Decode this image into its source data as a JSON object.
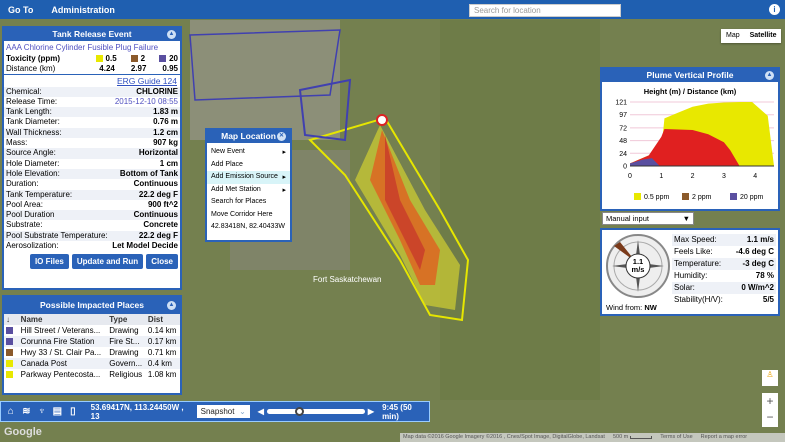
{
  "topbar": {
    "goto": "Go To",
    "admin": "Administration",
    "search_placeholder": "Search for location"
  },
  "maptype": {
    "map": "Map",
    "satellite": "Satellite"
  },
  "tank": {
    "title": "Tank Release Event",
    "event_name": "AAA Chlorine Cylinder Fusible Plug Failure",
    "toxicity_label": "Toxicity (ppm)",
    "distance_label": "Distance (km)",
    "levels": [
      {
        "ppm": "0.5",
        "color": "#e8e800",
        "dist": "4.24"
      },
      {
        "ppm": "2",
        "color": "#8b5a2b",
        "dist": "2.97"
      },
      {
        "ppm": "20",
        "color": "#5a4fa0",
        "dist": "0.95"
      }
    ],
    "erg": "ERG Guide 124",
    "props": [
      [
        "Chemical:",
        "CHLORINE"
      ],
      [
        "Release Time:",
        "2015-12-10 08:55"
      ],
      [
        "Tank Length:",
        "1.83 m"
      ],
      [
        "Tank Diameter:",
        "0.76 m"
      ],
      [
        "Wall Thickness:",
        "1.2 cm"
      ],
      [
        "Mass:",
        "907 kg"
      ],
      [
        "Source Angle:",
        "Horizontal"
      ],
      [
        "Hole Diameter:",
        "1 cm"
      ],
      [
        "Hole Elevation:",
        "Bottom of Tank"
      ],
      [
        "Duration:",
        "Continuous"
      ],
      [
        "Tank Temperature:",
        "22.2 deg F"
      ],
      [
        "Pool Area:",
        "900 ft^2"
      ],
      [
        "Pool Duration",
        "Continuous"
      ],
      [
        "Substrate:",
        "Concrete"
      ],
      [
        "Pool Substrate Temperature:",
        "22.2 deg F"
      ],
      [
        "Aerosolization:",
        "Let Model Decide"
      ]
    ],
    "buttons": {
      "io": "IO Files",
      "update": "Update and Run",
      "close": "Close"
    }
  },
  "places": {
    "title": "Possible Impacted Places",
    "headers": [
      "Name",
      "Type",
      "Dist"
    ],
    "rows": [
      {
        "color": "#5a4fa0",
        "name": "Hill Street / Veterans...",
        "type": "Drawing",
        "dist": "0.14 km"
      },
      {
        "color": "#5a4fa0",
        "name": "Corunna Fire Station",
        "type": "Fire St...",
        "dist": "0.17 km"
      },
      {
        "color": "#8b5a2b",
        "name": "Hwy 33 / St. Clair Pa...",
        "type": "Drawing",
        "dist": "0.71 km"
      },
      {
        "color": "#e8e800",
        "name": "Canada Post",
        "type": "Govern...",
        "dist": "0.4 km"
      },
      {
        "color": "#e8e800",
        "name": "Parkway Pentecosta...",
        "type": "Religious",
        "dist": "1.08 km"
      }
    ]
  },
  "menu": {
    "title": "Map Location",
    "items": [
      {
        "label": "New Event",
        "sub": true
      },
      {
        "label": "Add Place",
        "sub": false
      },
      {
        "label": "Add Emission Source",
        "sub": true
      },
      {
        "label": "Add Met Station",
        "sub": true
      },
      {
        "label": "Search for Places",
        "sub": false
      },
      {
        "label": "Move Corridor Here",
        "sub": false
      }
    ],
    "coords": "42.83418N, 82.40433W"
  },
  "profile": {
    "title": "Plume Vertical Profile",
    "chart_title": "Height (m) / Distance (km)",
    "chart_data": {
      "type": "area",
      "title": "Height (m) / Distance (km)",
      "ylim": [
        0,
        121
      ],
      "xlim": [
        0,
        4.6
      ],
      "yticks": [
        0,
        24,
        48,
        72,
        97,
        121
      ],
      "xticks": [
        0,
        1,
        2,
        3,
        4
      ],
      "series": [
        {
          "name": "0.5 ppm",
          "color": "#e8e800",
          "x": [
            0,
            0.6,
            1.0,
            1.1,
            1.5,
            2.0,
            2.5,
            3.0,
            3.5,
            3.9,
            4.4,
            4.6
          ],
          "y": [
            5,
            20,
            30,
            90,
            100,
            112,
            118,
            120,
            121,
            121,
            95,
            0
          ]
        },
        {
          "name": "2 ppm",
          "color": "#8b5a2b",
          "x": [
            0,
            0.6,
            1.0,
            1.1,
            2.0,
            2.5,
            3.0,
            3.2,
            3.5
          ],
          "y": [
            5,
            20,
            55,
            70,
            68,
            60,
            45,
            30,
            0
          ]
        },
        {
          "name": "20 ppm",
          "color": "#5a4fa0",
          "x": [
            0,
            0.4,
            0.7,
            0.95
          ],
          "y": [
            5,
            12,
            15,
            0
          ]
        }
      ]
    }
  },
  "weather": {
    "source": "Manual input",
    "speed": "1.1",
    "unit": "m/s",
    "wind_from_label": "Wind from:",
    "wind_from": "NW",
    "rows": [
      [
        "Max Speed:",
        "1.1 m/s"
      ],
      [
        "Feels Like:",
        "-4.6 deg C"
      ],
      [
        "Temperature:",
        "-3 deg C"
      ],
      [
        "Humidity:",
        "78 %"
      ],
      [
        "Solar:",
        "0 W/m^2"
      ],
      [
        "Stability(H/V):",
        "5/5"
      ]
    ]
  },
  "toolbar": {
    "coords": "53.69417N, 113.24450W , 13",
    "mode": "Snapshot",
    "time": "9:45 (50 min)",
    "progress": 0.33
  },
  "map": {
    "town": "Fort Saskatchewan",
    "attribution": "Map data ©2016 Google Imagery ©2016 , Cnes/Spot Image, DigitalGlobe, Landsat",
    "scale": "500 m",
    "terms": "Terms of Use",
    "report": "Report a map error",
    "google": "Google"
  }
}
